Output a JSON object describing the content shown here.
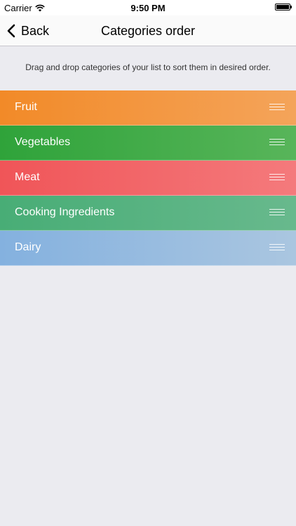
{
  "status_bar": {
    "carrier": "Carrier",
    "time": "9:50 PM"
  },
  "nav": {
    "back_label": "Back",
    "title": "Categories order"
  },
  "instruction": "Drag and drop categories of your list to sort them in desired order.",
  "categories": [
    {
      "label": "Fruit",
      "color_start": "#f28a28",
      "color_end": "#f4a45a"
    },
    {
      "label": "Vegetables",
      "color_start": "#2fa33a",
      "color_end": "#58b55a"
    },
    {
      "label": "Meat",
      "color_start": "#f05558",
      "color_end": "#f47a7c"
    },
    {
      "label": "Cooking Ingredients",
      "color_start": "#48ad76",
      "color_end": "#68b98d"
    },
    {
      "label": "Dairy",
      "color_start": "#84b1df",
      "color_end": "#aac6e0"
    }
  ],
  "icons": {
    "wifi": "wifi-icon",
    "battery": "battery-icon",
    "back": "chevron-left-icon",
    "handle": "drag-handle-icon"
  }
}
